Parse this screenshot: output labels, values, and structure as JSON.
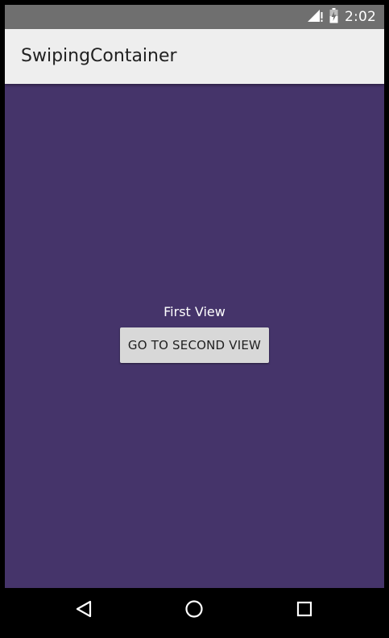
{
  "status_bar": {
    "time": "2:02",
    "icons": [
      "signal-icon",
      "alert-icon",
      "battery-icon"
    ]
  },
  "app_bar": {
    "title": "SwipingContainer"
  },
  "main": {
    "view_label": "First View",
    "button_label": "GO TO SECOND VIEW"
  },
  "nav_bar": {
    "buttons": [
      "back-icon",
      "home-icon",
      "recents-icon"
    ]
  },
  "colors": {
    "background": "#45346a",
    "app_bar": "#eeeeee",
    "status_bar": "#6f6f6f",
    "button": "#d8d8d8"
  }
}
